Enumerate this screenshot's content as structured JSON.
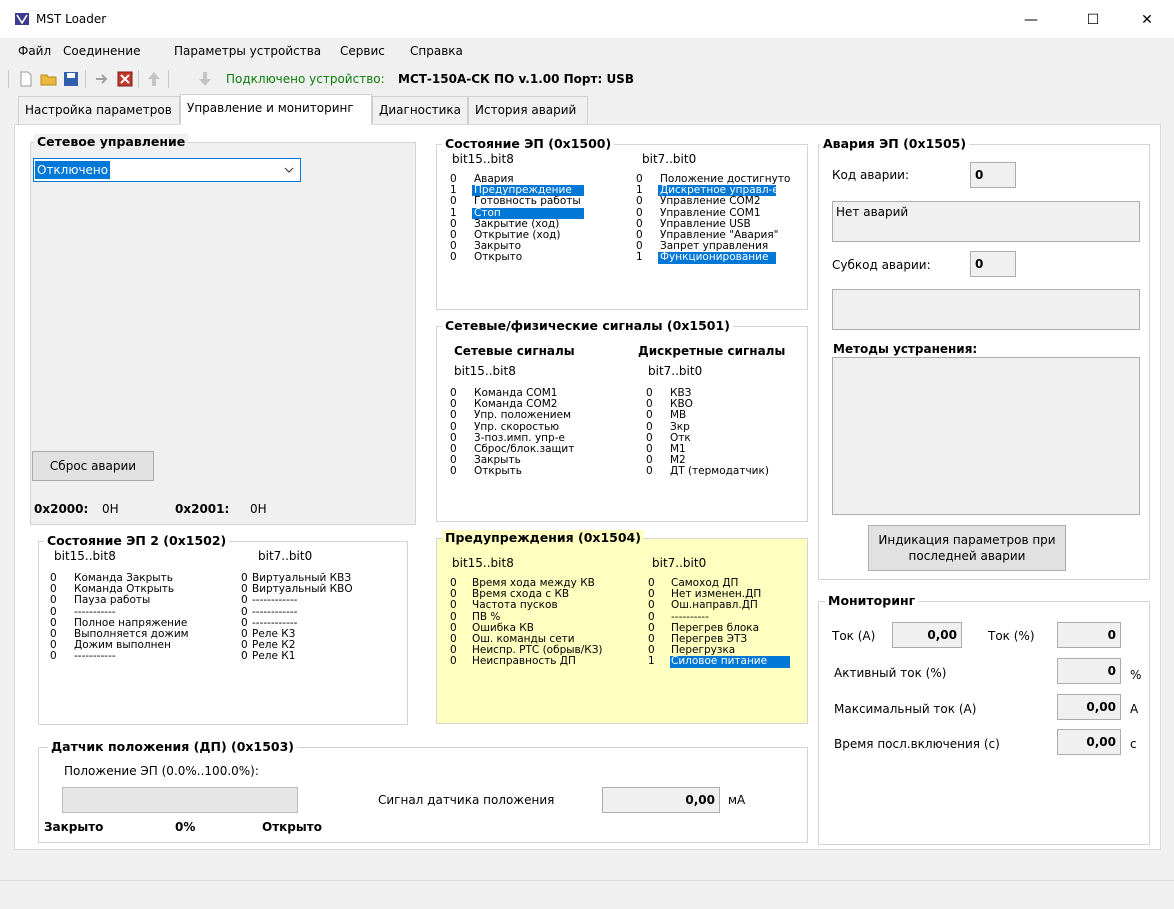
{
  "window": {
    "title": "MST Loader",
    "minimize": "—",
    "maximize": "☐",
    "close": "✕"
  },
  "menu": {
    "items": [
      "Файл",
      "Соединение",
      "Параметры устройства",
      "Сервис",
      "Справка"
    ]
  },
  "toolbar": {
    "status_label": "Подключено устройство:",
    "status_value": "МСТ-150А-СК ПО v.1.00   Порт: USB"
  },
  "tabs": [
    "Настройка параметров",
    "Управление и мониторинг",
    "Диагностика",
    "История аварий"
  ],
  "net_control": {
    "title": "Сетевое управление",
    "selected": "Отключено",
    "reset_button": "Сброс аварии",
    "reg1_label": "0x2000:",
    "reg1_value": "0H",
    "reg2_label": "0x2001:",
    "reg2_value": "0H"
  },
  "state": {
    "title": "Состояние ЭП (0x1500)",
    "col1_header": "bit15..bit8",
    "col2_header": "bit7..bit0",
    "high": [
      {
        "v": "0",
        "t": "Авария"
      },
      {
        "v": "1",
        "t": "Предупреждение"
      },
      {
        "v": "0",
        "t": "Готовность работы"
      },
      {
        "v": "1",
        "t": "Стоп"
      },
      {
        "v": "0",
        "t": "Закрытие (ход)"
      },
      {
        "v": "0",
        "t": "Открытие (ход)"
      },
      {
        "v": "0",
        "t": "Закрыто"
      },
      {
        "v": "0",
        "t": "Открыто"
      }
    ],
    "low": [
      {
        "v": "0",
        "t": "Положение достигнуто"
      },
      {
        "v": "1",
        "t": "Дискретное управл-е"
      },
      {
        "v": "0",
        "t": "Управление COM2"
      },
      {
        "v": "0",
        "t": "Управление COM1"
      },
      {
        "v": "0",
        "t": "Управление USB"
      },
      {
        "v": "0",
        "t": "Управление \"Авария\""
      },
      {
        "v": "0",
        "t": "Запрет управления"
      },
      {
        "v": "1",
        "t": "Функционирование"
      }
    ]
  },
  "signals": {
    "title": "Сетевые/физические сигналы (0x1501)",
    "net_header": "Сетевые сигналы",
    "disc_header": "Дискретные сигналы",
    "col1_header": "bit15..bit8",
    "col2_header": "bit7..bit0",
    "net": [
      {
        "v": "0",
        "t": "Команда COM1"
      },
      {
        "v": "0",
        "t": "Команда COM2"
      },
      {
        "v": "0",
        "t": "Упр. положением"
      },
      {
        "v": "0",
        "t": "Упр. скоростью"
      },
      {
        "v": "0",
        "t": "3-поз.имп. упр-е"
      },
      {
        "v": "0",
        "t": "Сброс/блок.защит"
      },
      {
        "v": "0",
        "t": "Закрыть"
      },
      {
        "v": "0",
        "t": "Открыть"
      }
    ],
    "disc": [
      {
        "v": "0",
        "t": "КВЗ"
      },
      {
        "v": "0",
        "t": "КВО"
      },
      {
        "v": "0",
        "t": "МВ"
      },
      {
        "v": "0",
        "t": "Зкр"
      },
      {
        "v": "0",
        "t": "Отк"
      },
      {
        "v": "0",
        "t": "М1"
      },
      {
        "v": "0",
        "t": "М2"
      },
      {
        "v": "0",
        "t": "ДТ (термодатчик)"
      }
    ]
  },
  "state2": {
    "title": "Состояние ЭП 2 (0x1502)",
    "col1_header": "bit15..bit8",
    "col2_header": "bit7..bit0",
    "high": [
      {
        "v": "0",
        "t": "Команда Закрыть"
      },
      {
        "v": "0",
        "t": "Команда Открыть"
      },
      {
        "v": "0",
        "t": "Пауза работы"
      },
      {
        "v": "0",
        "t": "-----------"
      },
      {
        "v": "0",
        "t": "Полное напряжение"
      },
      {
        "v": "0",
        "t": "Выполняется дожим"
      },
      {
        "v": "0",
        "t": "Дожим выполнен"
      },
      {
        "v": "0",
        "t": "-----------"
      }
    ],
    "low": [
      {
        "v": "0",
        "t": "Виртуальный КВЗ"
      },
      {
        "v": "0",
        "t": "Виртуальный КВО"
      },
      {
        "v": "0",
        "t": "------------"
      },
      {
        "v": "0",
        "t": "------------"
      },
      {
        "v": "0",
        "t": "------------"
      },
      {
        "v": "0",
        "t": "Реле К3"
      },
      {
        "v": "0",
        "t": "Реле К2"
      },
      {
        "v": "0",
        "t": "Реле К1"
      }
    ]
  },
  "warnings": {
    "title": "Предупреждения (0x1504)",
    "col1_header": "bit15..bit8",
    "col2_header": "bit7..bit0",
    "high": [
      {
        "v": "0",
        "t": "Время хода между КВ"
      },
      {
        "v": "0",
        "t": "Время схода с КВ"
      },
      {
        "v": "0",
        "t": "Частота пусков"
      },
      {
        "v": "0",
        "t": "ПВ %"
      },
      {
        "v": "0",
        "t": "Ошибка КВ"
      },
      {
        "v": "0",
        "t": "Ош. команды сети"
      },
      {
        "v": "0",
        "t": "Неиспр. РТС (обрыв/КЗ)"
      },
      {
        "v": "0",
        "t": "Неисправность ДП"
      }
    ],
    "low": [
      {
        "v": "0",
        "t": "Самоход ДП"
      },
      {
        "v": "0",
        "t": "Нет изменен.ДП"
      },
      {
        "v": "0",
        "t": "Ош.направл.ДП"
      },
      {
        "v": "0",
        "t": "----------"
      },
      {
        "v": "0",
        "t": "Перегрев блока"
      },
      {
        "v": "0",
        "t": "Перегрев ЭТЗ"
      },
      {
        "v": "0",
        "t": "Перегрузка"
      },
      {
        "v": "1",
        "t": "Силовое питание"
      }
    ]
  },
  "sensor": {
    "title": "Датчик положения (ДП) (0x1503)",
    "position_label": "Положение ЭП (0.0%..100.0%):",
    "position_fraction": 0.0,
    "closed_label": "Закрыто",
    "percent": "0%",
    "open_label": "Открыто",
    "signal_label": "Сигнал датчика положения",
    "signal_value": "0,00",
    "signal_unit": "мА"
  },
  "alarm": {
    "title": "Авария ЭП (0x1505)",
    "code_label": "Код аварии:",
    "code_value": "0",
    "message": "Нет аварий",
    "subcode_label": "Субкод аварии:",
    "subcode_value": "0",
    "sub_message": "",
    "methods_label": "Методы устранения:",
    "methods_text": "",
    "params_button": "Индикация параметров при последней аварии"
  },
  "monitor": {
    "title": "Мониторинг",
    "current_a_label": "Ток (А)",
    "current_a_value": "0,00",
    "current_pct_label": "Ток (%)",
    "current_pct_value": "0",
    "active_label": "Активный ток (%)",
    "active_value": "0",
    "active_unit": "%",
    "max_label": "Максимальный ток (А)",
    "max_value": "0,00",
    "max_unit": "А",
    "time_label": "Время посл.включения (с)",
    "time_value": "0,00",
    "time_unit": "с"
  }
}
